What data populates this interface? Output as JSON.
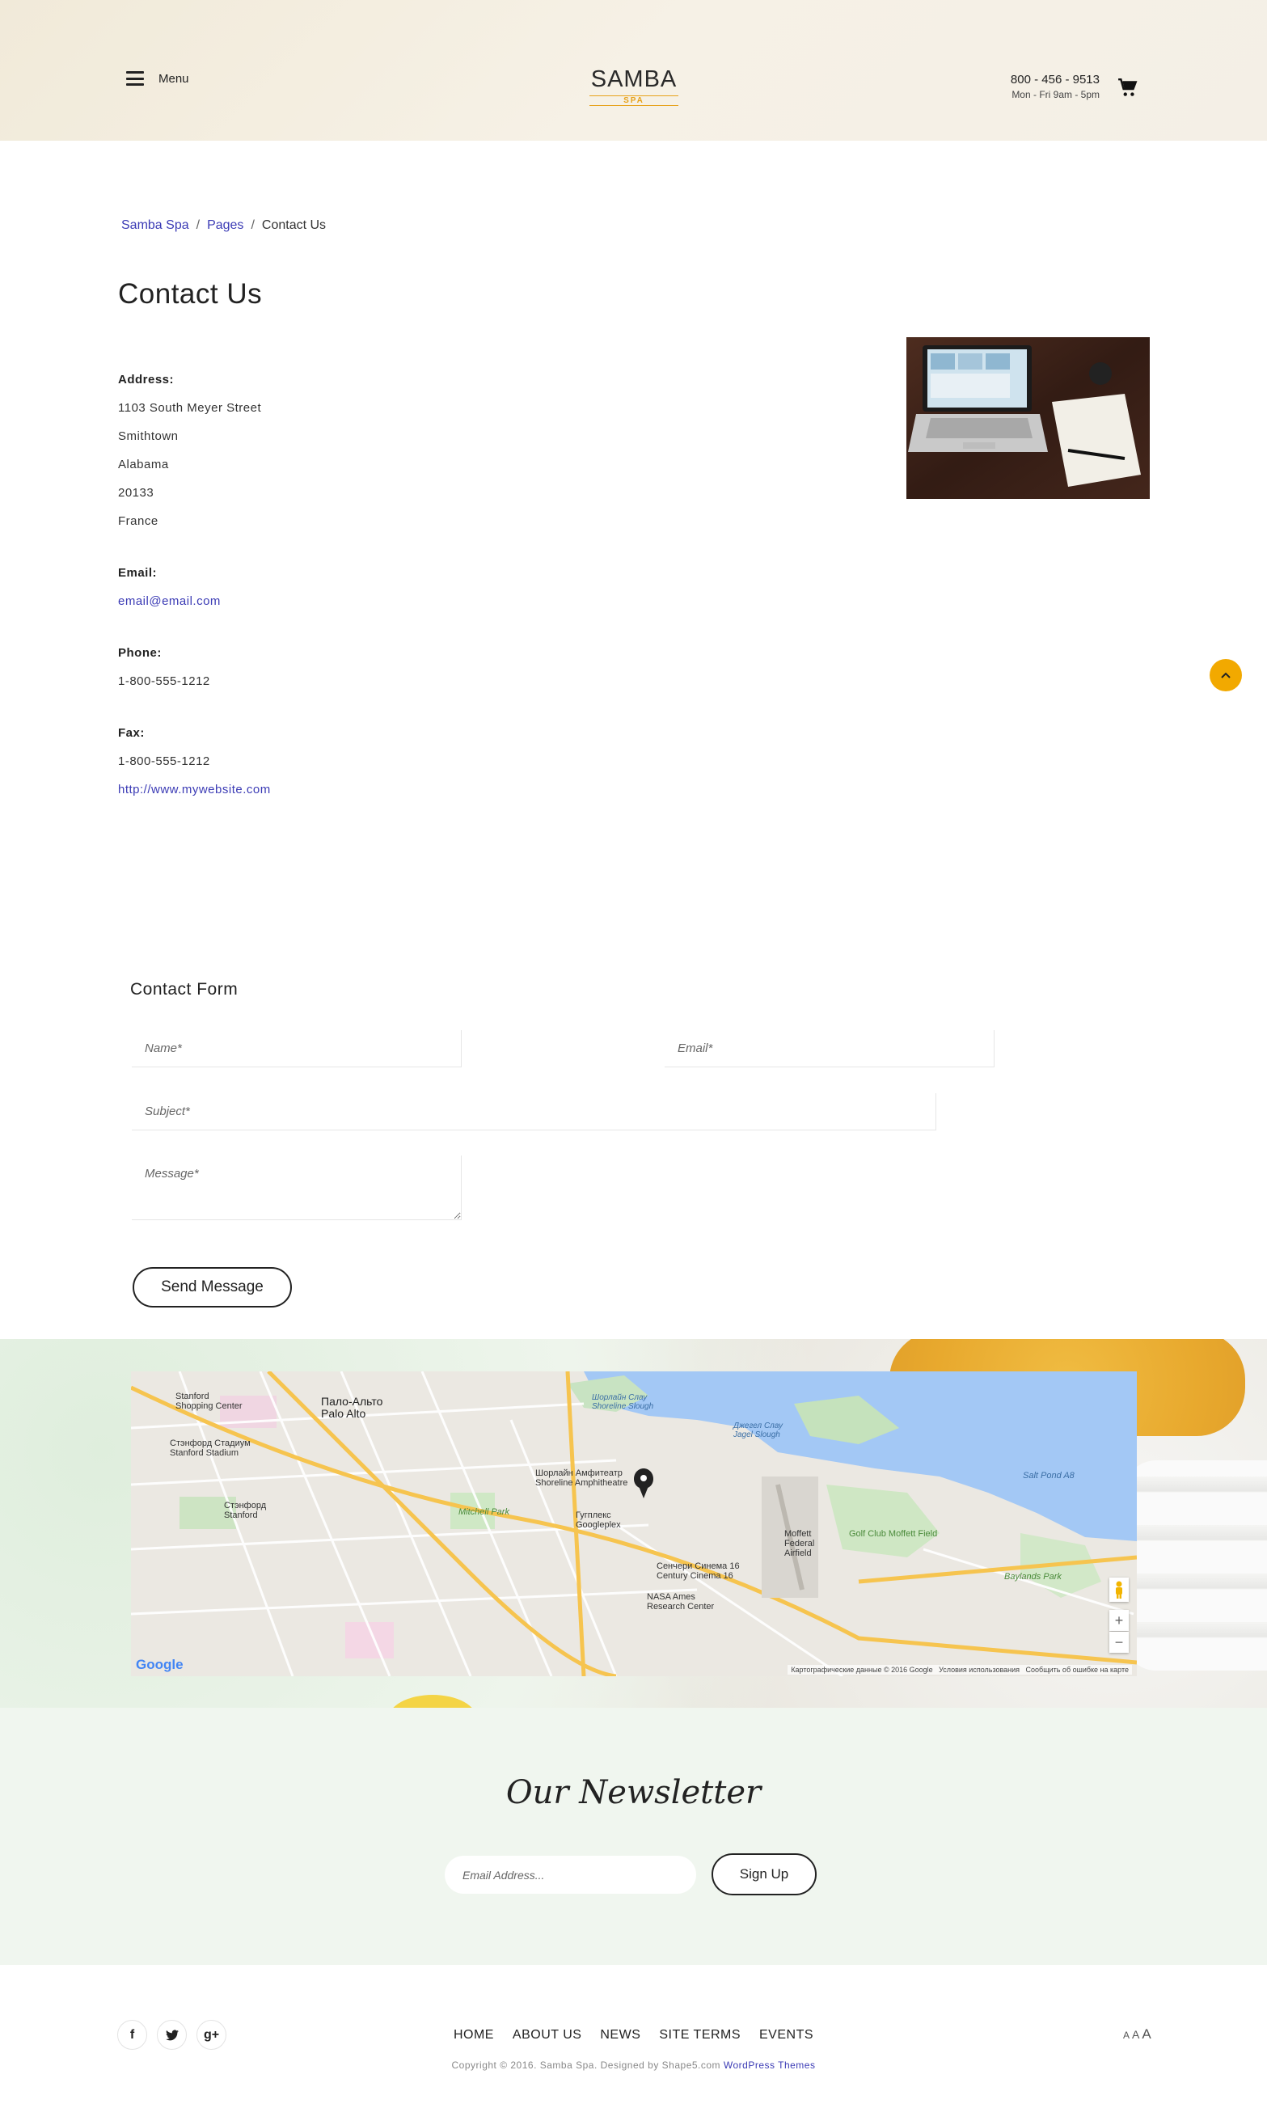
{
  "header": {
    "menu_label": "Menu",
    "logo_main": "SAMBA",
    "logo_sub": "SPA",
    "phone": "800 - 456 - 9513",
    "hours": "Mon - Fri 9am - 5pm"
  },
  "breadcrumb": {
    "items": [
      "Samba Spa",
      "Pages"
    ],
    "current": "Contact Us",
    "separator": "/"
  },
  "page": {
    "title": "Contact Us"
  },
  "contact": {
    "address_label": "Address:",
    "address_lines": [
      "1103 South Meyer Street",
      "Smithtown",
      "Alabama",
      "20133",
      "France"
    ],
    "email_label": "Email:",
    "email": "email@email.com",
    "phone_label": "Phone:",
    "phone": "1-800-555-1212",
    "fax_label": "Fax:",
    "fax": "1-800-555-1212",
    "website": "http://www.mywebsite.com"
  },
  "form": {
    "title": "Contact Form",
    "name_placeholder": "Name*",
    "email_placeholder": "Email*",
    "subject_placeholder": "Subject*",
    "message_placeholder": "Message*",
    "submit_label": "Send Message"
  },
  "map": {
    "labels": {
      "stanford_sc": "Stanford\nShopping Center",
      "palo_alto": "Пало-Альто\nPalo Alto",
      "stanford_stadium": "Стэнфорд Стадиум\nStanford Stadium",
      "stanford": "Стэнфорд\nStanford",
      "mitchell_park": "Mitchell Park",
      "shoreline": "Шорлайн Амфитеатр\nShoreline Amphitheatre",
      "googleplex": "Гугплекс\nGoogleplex",
      "century": "Сенчери Синема 16\nCentury Cinema 16",
      "nasa": "NASA Ames\nResearch Center",
      "moffett": "Moffett\nFederal\nAirfield",
      "golf": "Golf Club Moffett Field",
      "baylands": "Baylands Park",
      "salt_pond": "Salt Pond A8",
      "shoreline_slough": "Шорлайн Слау\nShoreline Slough",
      "jagel": "Джегел Слау\nJagel Slough"
    },
    "google": "Google",
    "attribution": "Картографические данные © 2016 Google   Условия использования   Сообщить об ошибке на карте",
    "zoom_in": "+",
    "zoom_out": "−"
  },
  "newsletter": {
    "title": "Our Newsletter",
    "email_placeholder": "Email Address...",
    "signup_label": "Sign Up"
  },
  "footer": {
    "social": [
      "f",
      "twitter",
      "g+"
    ],
    "nav": [
      "HOME",
      "ABOUT US",
      "NEWS",
      "SITE TERMS",
      "EVENTS"
    ],
    "copyright_text": "Copyright © 2016. Samba Spa. Designed by Shape5.com ",
    "copyright_link": "WordPress Themes",
    "font_sizes": [
      "A",
      "A",
      "A"
    ]
  },
  "colors": {
    "accent": "#f2a900",
    "link": "#3b3bb5",
    "newsletter_bg": "#f0f6ef"
  }
}
